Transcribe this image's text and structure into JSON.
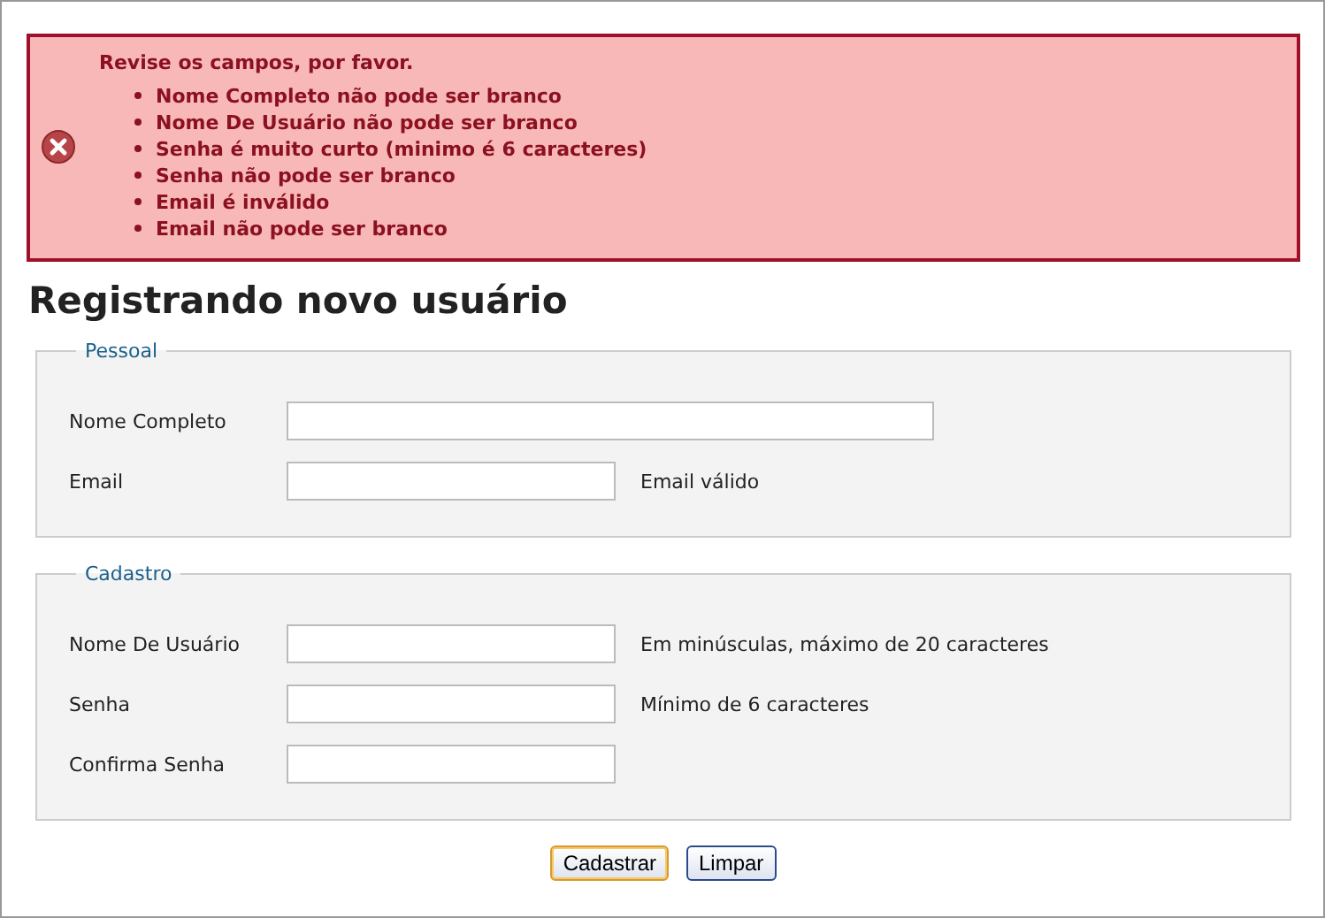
{
  "errors": {
    "title": "Revise os campos, por favor.",
    "items": [
      "Nome Completo não pode ser branco",
      "Nome De Usuário não pode ser branco",
      "Senha é muito curto (minimo é 6 caracteres)",
      "Senha não pode ser branco",
      "Email é inválido",
      "Email não pode ser branco"
    ]
  },
  "heading": "Registrando novo usuário",
  "fieldsets": [
    {
      "legend": "Pessoal",
      "fields": [
        {
          "label": "Nome Completo",
          "kind": "wide"
        },
        {
          "label": "Email",
          "kind": "short",
          "hint": "Email válido"
        }
      ]
    },
    {
      "legend": "Cadastro",
      "fields": [
        {
          "label": "Nome De Usuário",
          "kind": "short",
          "hint": "Em minúsculas, máximo de 20 caracteres"
        },
        {
          "label": "Senha",
          "kind": "short",
          "hint": "Mínimo de 6 caracteres"
        },
        {
          "label": "Confirma Senha",
          "kind": "short"
        }
      ]
    }
  ],
  "buttons": [
    {
      "label": "Cadastrar",
      "focused": true
    },
    {
      "label": "Limpar",
      "focused": false
    }
  ]
}
